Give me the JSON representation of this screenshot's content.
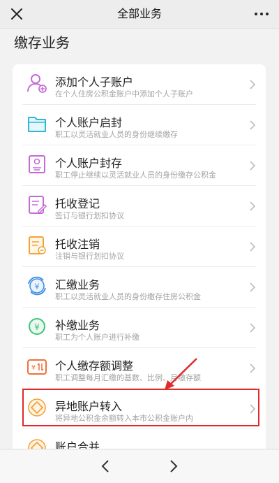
{
  "header": {
    "title": "全部业务"
  },
  "section": {
    "title": "缴存业务"
  },
  "items": [
    {
      "label": "添加个人子账户",
      "desc": "在个人住房公积金账户中添加个人子账户",
      "icon": "person-add-icon",
      "color": "#c66bd6"
    },
    {
      "label": "个人账户启封",
      "desc": "职工以灵活就业人员的身份继续缴存",
      "icon": "folder-open-icon",
      "color": "#2fb7d8"
    },
    {
      "label": "个人账户封存",
      "desc": "职工停止继续以灵活就业人员的身份缴存公积金",
      "icon": "account-seal-icon",
      "color": "#c66bd6"
    },
    {
      "label": "托收登记",
      "desc": "签订与银行划扣协议",
      "icon": "document-edit-icon",
      "color": "#c66bd6"
    },
    {
      "label": "托收注销",
      "desc": "注销与银行划扣协议",
      "icon": "document-cancel-icon",
      "color": "#f2a33a"
    },
    {
      "label": "汇缴业务",
      "desc": "职工以灵活就业人员的身份缴存住房公积金",
      "icon": "yuan-cycle-icon",
      "color": "#3b8be0"
    },
    {
      "label": "补缴业务",
      "desc": "职工为个人账户进行补缴",
      "icon": "yuan-coin-icon",
      "color": "#3ec27a"
    },
    {
      "label": "个人缴存额调整",
      "desc": "职工调整每月汇缴的基数、比例、月缴存额",
      "icon": "amount-adjust-icon",
      "color": "#f0713a"
    },
    {
      "label": "异地账户转入",
      "desc": "将异地公积金余额转入本市公积金账户内",
      "icon": "transfer-in-icon",
      "color": "#f2a33a"
    },
    {
      "label": "账户合并",
      "desc": "",
      "icon": "account-merge-icon",
      "color": "#f2a33a"
    }
  ],
  "highlight": {
    "color": "#e12a2a",
    "target": "异地账户转入"
  }
}
